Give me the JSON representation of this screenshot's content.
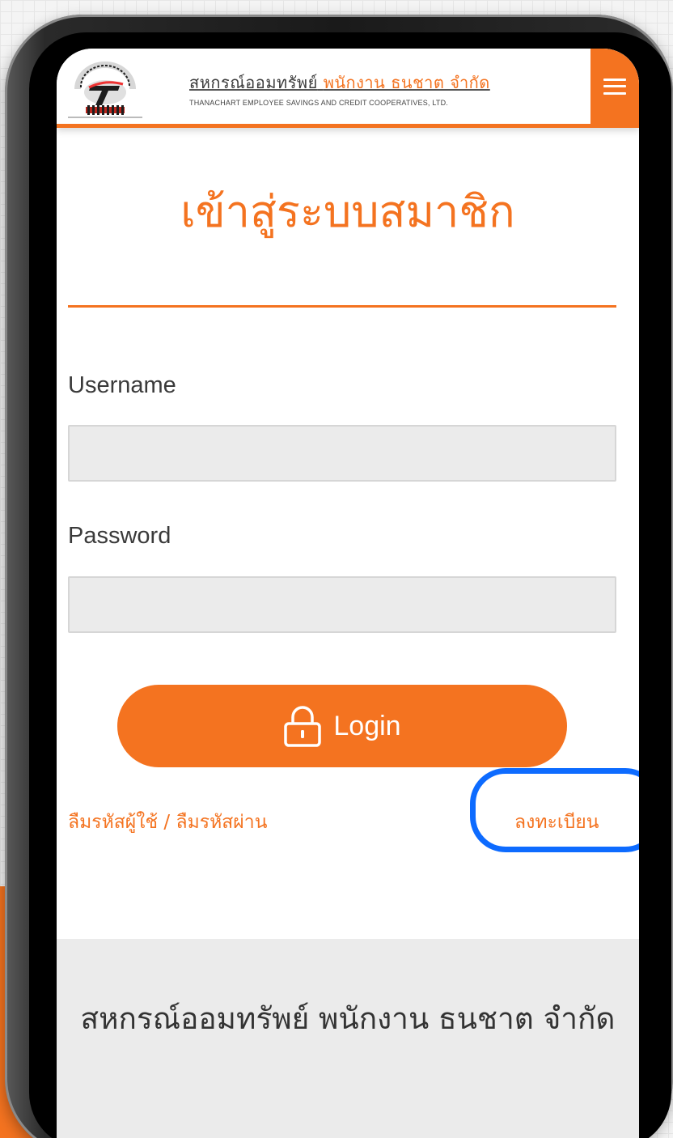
{
  "header": {
    "brand_thai_main": "สหกรณ์ออมทรัพย์",
    "brand_thai_accent": "พนักงาน ธนชาต จำกัด",
    "brand_en": "THANACHART EMPLOYEE SAVINGS AND CREDIT COOPERATIVES, LTD.",
    "logo_icon": "cooperative-logo",
    "menu_icon": "hamburger-menu-icon"
  },
  "login": {
    "title": "เข้าสู่ระบบสมาชิก",
    "username_label": "Username",
    "username_value": "",
    "password_label": "Password",
    "password_value": "",
    "login_button": "Login",
    "login_icon": "lock-icon",
    "forgot_link": "ลืมรหัสผู้ใช้ / ลืมรหัสผ่าน",
    "register_link": "ลงทะเบียน"
  },
  "footer": {
    "org_name": "สหกรณ์ออมทรัพย์ พนักงาน ธนชาต จำกัด"
  },
  "colors": {
    "accent": "#f47320",
    "highlight": "#0d6bff",
    "footer_bg": "#ebebeb",
    "input_bg": "#ebebeb"
  }
}
